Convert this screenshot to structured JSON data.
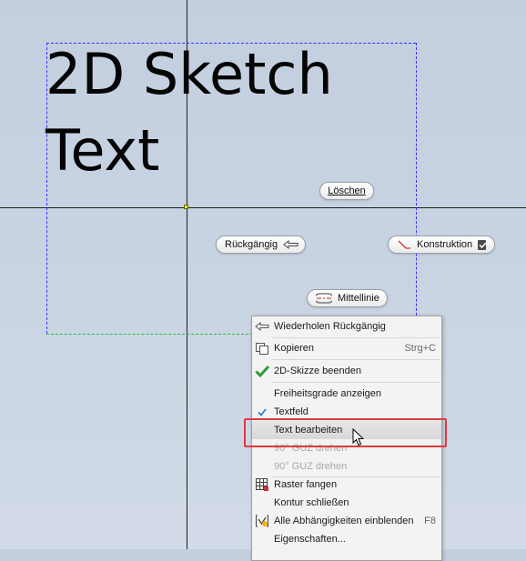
{
  "canvas": {
    "sketch_text_line1": "2D Sketch",
    "sketch_text_line2": "Text"
  },
  "pills": {
    "loeschen": "Löschen",
    "rueckgaengig": "Rückgängig",
    "konstruktion": "Konstruktion",
    "mittellinie": "Mittellinie"
  },
  "menu": {
    "items": [
      {
        "label": "Wiederholen Rückgängig",
        "icon": "redo-arrow-icon"
      },
      {
        "label": "Kopieren",
        "shortcut": "Strg+C",
        "icon": "copy-icon"
      },
      {
        "label": "2D-Skizze beenden",
        "icon": "green-check-icon"
      },
      {
        "label": "Freiheitsgrade anzeigen"
      },
      {
        "label": "Textfeld",
        "checked": true,
        "icon": "check-icon"
      },
      {
        "label": "Text bearbeiten",
        "highlighted": true
      },
      {
        "label": "90° GUZ drehen",
        "disabled": true
      },
      {
        "label": "90° GUZ drehen",
        "disabled": true
      },
      {
        "label": "Raster fangen",
        "icon": "grid-snap-icon"
      },
      {
        "label": "Kontur schließen"
      },
      {
        "label": "Alle Abhängigkeiten einblenden",
        "shortcut": "F8",
        "icon": "constraints-icon"
      },
      {
        "label": "Eigenschaften..."
      }
    ]
  },
  "colors": {
    "highlight_box": "#e0393e",
    "check_green": "#2a9d3a",
    "check_blue": "#2a7fd4"
  }
}
